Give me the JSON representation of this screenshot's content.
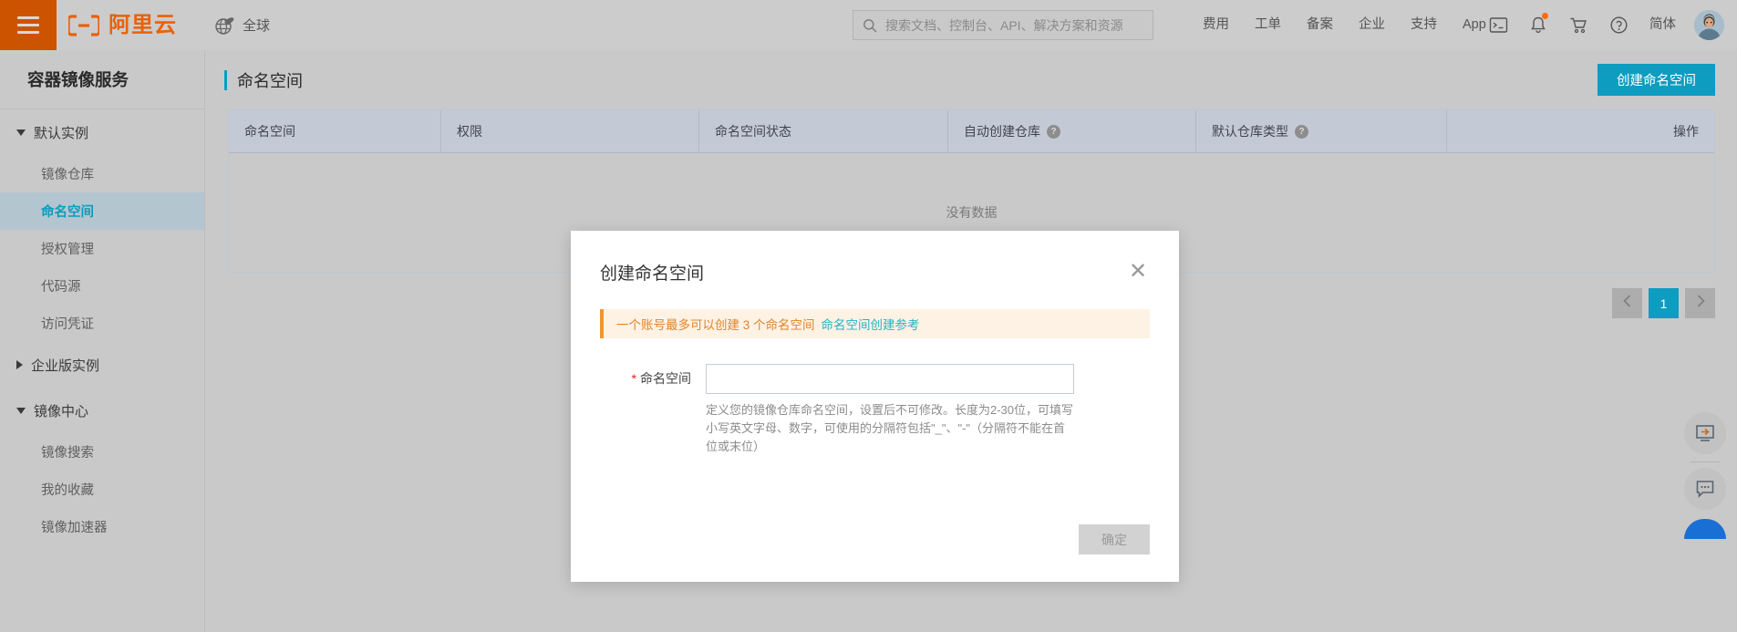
{
  "header": {
    "menu_icon": "hamburger-icon",
    "brand": "阿里云",
    "region_label": "全球",
    "region_icon": "globe-icon",
    "search": {
      "icon": "search-icon",
      "placeholder": "搜索文档、控制台、API、解决方案和资源",
      "value": ""
    },
    "nav": [
      {
        "label": "费用"
      },
      {
        "label": "工单"
      },
      {
        "label": "备案"
      },
      {
        "label": "企业"
      },
      {
        "label": "支持"
      },
      {
        "label": "App"
      }
    ],
    "icons": [
      {
        "name": "console-terminal-icon"
      },
      {
        "name": "bell-icon",
        "has_badge": true
      },
      {
        "name": "cart-icon"
      },
      {
        "name": "help-circle-icon"
      }
    ],
    "language": "简体",
    "avatar": "user-avatar"
  },
  "sidebar": {
    "title": "容器镜像服务",
    "groups": [
      {
        "label": "默认实例",
        "expanded": true,
        "items": [
          {
            "label": "镜像仓库",
            "active": false
          },
          {
            "label": "命名空间",
            "active": true
          },
          {
            "label": "授权管理",
            "active": false
          },
          {
            "label": "代码源",
            "active": false
          },
          {
            "label": "访问凭证",
            "active": false
          }
        ]
      },
      {
        "label": "企业版实例",
        "expanded": false,
        "items": []
      },
      {
        "label": "镜像中心",
        "expanded": true,
        "items": [
          {
            "label": "镜像搜索",
            "active": false
          },
          {
            "label": "我的收藏",
            "active": false
          },
          {
            "label": "镜像加速器",
            "active": false
          }
        ]
      }
    ]
  },
  "page": {
    "title": "命名空间",
    "create_button": "创建命名空间"
  },
  "table": {
    "columns": [
      {
        "label": "命名空间",
        "help": false,
        "align": "left"
      },
      {
        "label": "权限",
        "help": false,
        "align": "left"
      },
      {
        "label": "命名空间状态",
        "help": false,
        "align": "left"
      },
      {
        "label": "自动创建仓库",
        "help": true,
        "align": "left"
      },
      {
        "label": "默认仓库类型",
        "help": true,
        "align": "left"
      },
      {
        "label": "操作",
        "help": false,
        "align": "right"
      }
    ],
    "rows": [],
    "empty_text": "没有数据"
  },
  "pagination": {
    "prev_icon": "chevron-left-icon",
    "next_icon": "chevron-right-icon",
    "current_page": "1"
  },
  "floating_actions": [
    {
      "name": "remote-console-icon"
    },
    {
      "name": "chat-bubble-icon"
    }
  ],
  "modal": {
    "title": "创建命名空间",
    "close_icon": "close-icon",
    "alert": {
      "text": "一个账号最多可以创建 3 个命名空间",
      "link": "命名空间创建参考"
    },
    "field": {
      "required_mark": "*",
      "label": "命名空间",
      "value": "",
      "placeholder": "",
      "help": "定义您的镜像仓库命名空间，设置后不可修改。长度为2-30位，可填写小写英文字母、数字，可使用的分隔符包括\"_\"、\"-\"（分隔符不能在首位或末位）"
    },
    "confirm_button": "确定"
  }
}
